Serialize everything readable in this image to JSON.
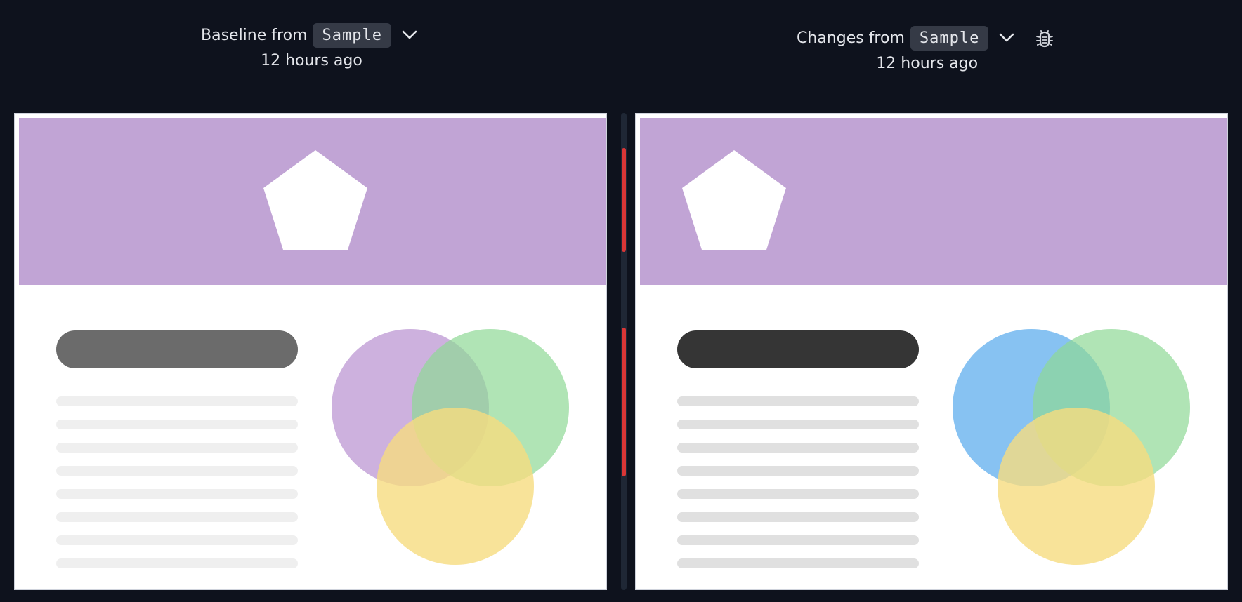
{
  "baseline": {
    "label": "Baseline from",
    "branch": "Sample",
    "time": "12 hours ago"
  },
  "changes": {
    "label": "Changes from",
    "branch": "Sample",
    "time": "12 hours ago"
  },
  "icons": {
    "baseline_dropdown": "chevron-down-icon",
    "changes_dropdown": "chevron-down-icon",
    "debug": "bug-icon"
  },
  "colors": {
    "background": "#0e121d",
    "banner": "#c1a4d5",
    "diff_marker": "#d93636",
    "baseline_title_bar": "#6b6b6b",
    "changes_title_bar": "#353535",
    "baseline_text_lines": "#efefef",
    "changes_text_lines": "#e0e0e0",
    "baseline_circle_1": "#b890d0",
    "changes_circle_1": "#72b7f0",
    "circle_2": "#8fd996",
    "circle_3": "#f6dc80"
  }
}
